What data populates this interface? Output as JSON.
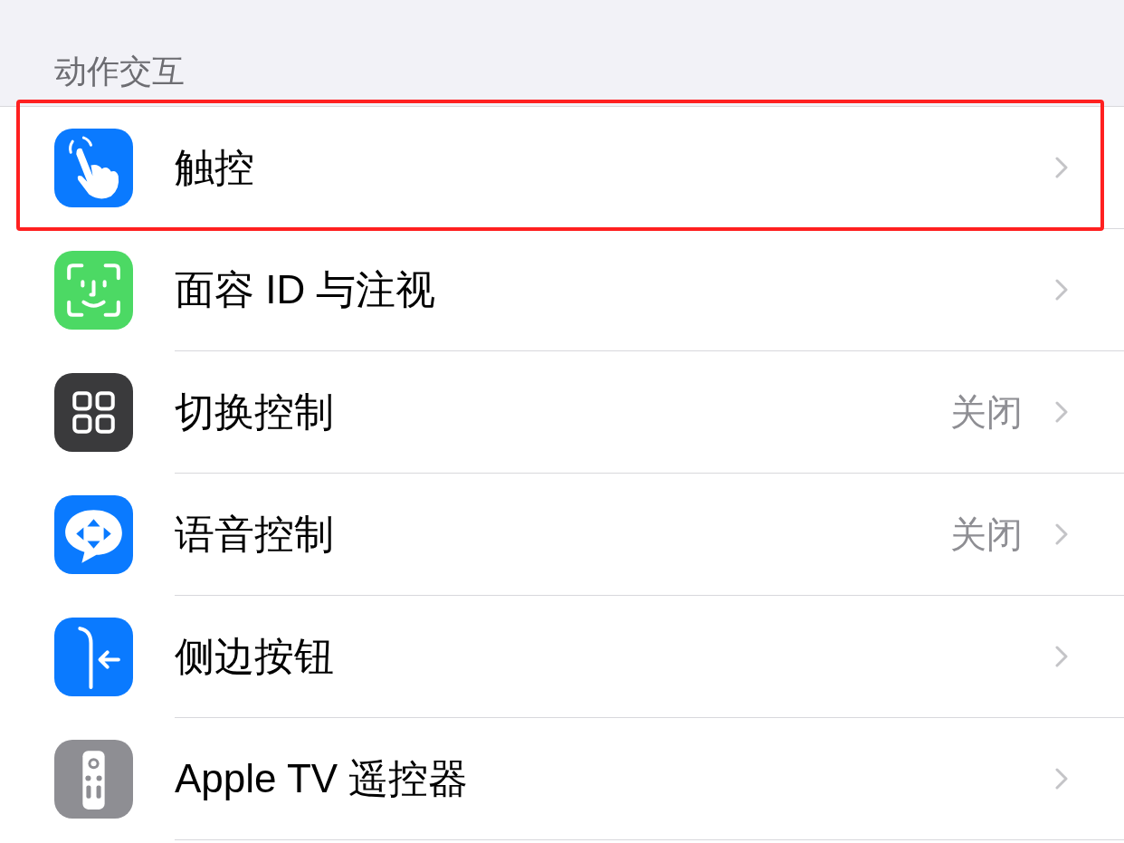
{
  "section": {
    "title": "动作交互"
  },
  "rows": [
    {
      "label": "触控",
      "color": "#0a7aff",
      "highlighted": true
    },
    {
      "label": "面容 ID 与注视",
      "color": "#4cd964",
      "highlighted": false
    },
    {
      "label": "切换控制",
      "value": "关闭",
      "color": "#3a3a3c",
      "highlighted": false
    },
    {
      "label": "语音控制",
      "value": "关闭",
      "color": "#0a7aff",
      "highlighted": false
    },
    {
      "label": "侧边按钮",
      "color": "#0a7aff",
      "highlighted": false
    },
    {
      "label": "Apple TV 遥控器",
      "color": "#8e8e93",
      "highlighted": false
    }
  ]
}
